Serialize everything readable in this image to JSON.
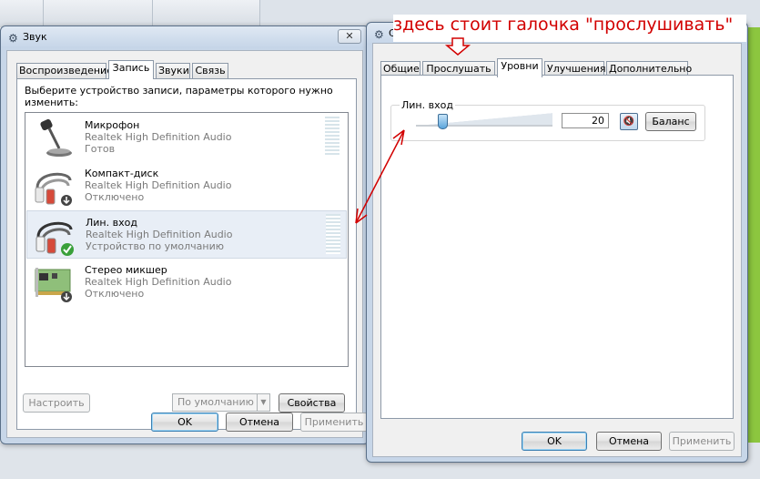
{
  "annotation": "здесь  стоит галочка \"прослушивать\"",
  "sound_window": {
    "title": "Звук",
    "close_label": "✕",
    "tabs": [
      {
        "label": "Воспроизведение"
      },
      {
        "label": "Запись",
        "active": true
      },
      {
        "label": "Звуки"
      },
      {
        "label": "Связь"
      }
    ],
    "instruction": "Выберите устройство записи, параметры которого нужно изменить:",
    "devices": [
      {
        "name": "Микрофон",
        "driver": "Realtek High Definition Audio",
        "status": "Готов",
        "icon": "microphone-icon"
      },
      {
        "name": "Компакт-диск",
        "driver": "Realtek High Definition Audio",
        "status": "Отключено",
        "icon": "rca-cable-icon"
      },
      {
        "name": "Лин. вход",
        "driver": "Realtek High Definition Audio",
        "status": "Устройство по умолчанию",
        "icon": "rca-cable-icon",
        "selected": true
      },
      {
        "name": "Стерео микшер",
        "driver": "Realtek High Definition Audio",
        "status": "Отключено",
        "icon": "sound-card-icon"
      }
    ],
    "configure_label": "Настроить",
    "default_label": "По умолчанию",
    "properties_label": "Свойства",
    "ok_label": "OK",
    "cancel_label": "Отмена",
    "apply_label": "Применить"
  },
  "props_window": {
    "title": "С",
    "close_label": "✕",
    "tabs": [
      {
        "label": "Общие"
      },
      {
        "label": "Прослушать"
      },
      {
        "label": "Уровни",
        "active": true
      },
      {
        "label": "Улучшения"
      },
      {
        "label": "Дополнительно"
      }
    ],
    "level_label": "Лин. вход",
    "level_value": "20",
    "level_fraction": 0.2,
    "balance_label": "Баланс",
    "ok_label": "OK",
    "cancel_label": "Отмена",
    "apply_label": "Применить"
  },
  "colors": {
    "annotation": "#d20000",
    "window_frame": "#c7d6e8",
    "selection": "#e8eef6"
  }
}
